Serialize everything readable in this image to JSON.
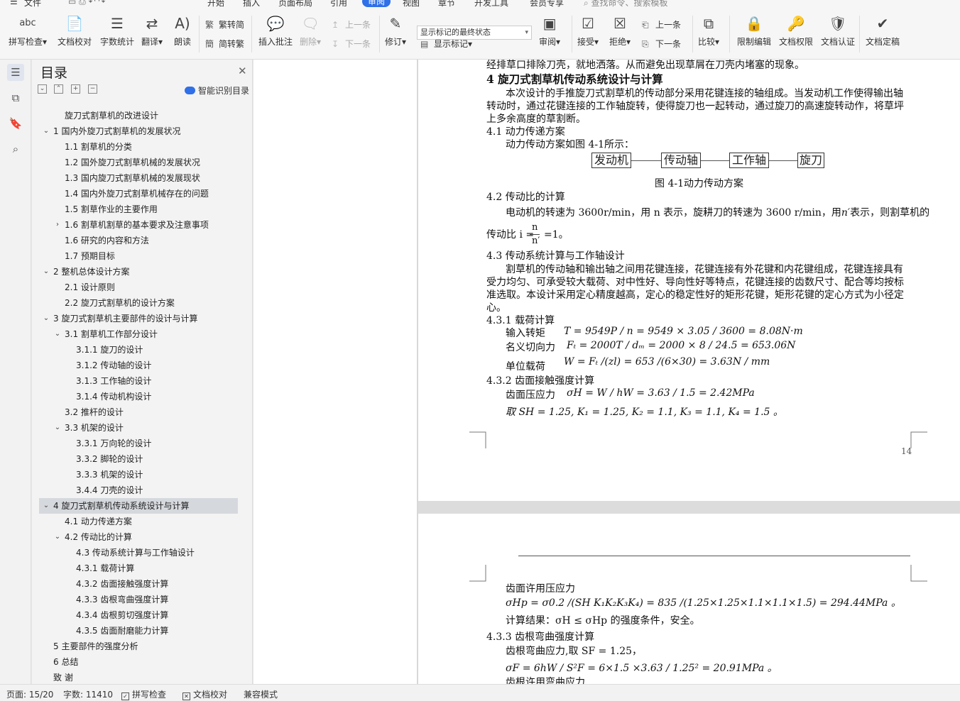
{
  "menubar": {
    "hamburger": "☰",
    "file": "文件",
    "items": [
      "开始",
      "插入",
      "页面布局",
      "引用",
      "审阅",
      "视图",
      "章节",
      "开发工具",
      "会员专享"
    ],
    "active_index": 4,
    "search": "查找命令、搜索模板"
  },
  "ribbon": {
    "spell_check": "拼写检查",
    "doc_proof": "文档校对",
    "word_count": "字数统计",
    "translate": "翻译",
    "read_aloud": "朗读",
    "trad_to_simp": "繁转简",
    "simp_to_trad": "简转繁",
    "insert_comment": "插入批注",
    "delete": "删除",
    "prev_comment": "上一条",
    "next_comment": "下一条",
    "revise": "修订",
    "markup_select": "显示标记的最终状态",
    "show_markup": "显示标记",
    "review": "审阅",
    "accept": "接受",
    "reject": "拒绝",
    "prev_change": "上一条",
    "next_change": "下一条",
    "compare": "比较",
    "restrict_edit": "限制编辑",
    "doc_permission": "文档权限",
    "doc_auth": "文档认证",
    "doc_finalize": "文档定稿"
  },
  "nav": {
    "title": "目录",
    "smart_toc": "智能识别目录",
    "items": [
      {
        "text": "旋刀式割草机的改进设计",
        "level": 1,
        "tw": ""
      },
      {
        "text": "1 国内外旋刀式割草机的发展状况",
        "level": 0,
        "tw": "v"
      },
      {
        "text": "1.1 割草机的分类",
        "level": 1,
        "tw": ""
      },
      {
        "text": "1.2 国外旋刀式割草机械的发展状况",
        "level": 1,
        "tw": ""
      },
      {
        "text": "1.3 国内旋刀式割草机械的发展现状",
        "level": 1,
        "tw": ""
      },
      {
        "text": "1.4 国内外旋刀式割草机械存在的问题",
        "level": 1,
        "tw": ""
      },
      {
        "text": "1.5 割草作业的主要作用",
        "level": 1,
        "tw": ""
      },
      {
        "text": "1.6 割草机割草的基本要求及注意事项",
        "level": 1,
        "tw": ">"
      },
      {
        "text": "1.6 研究的内容和方法",
        "level": 1,
        "tw": ""
      },
      {
        "text": "1.7 预期目标",
        "level": 1,
        "tw": ""
      },
      {
        "text": "2 整机总体设计方案",
        "level": 0,
        "tw": "v"
      },
      {
        "text": "2.1 设计原则",
        "level": 1,
        "tw": ""
      },
      {
        "text": "2.2 旋刀式割草机的设计方案",
        "level": 1,
        "tw": ""
      },
      {
        "text": "3 旋刀式割草机主要部件的设计与计算",
        "level": 0,
        "tw": "v"
      },
      {
        "text": "3.1 割草机工作部分设计",
        "level": 1,
        "tw": "v"
      },
      {
        "text": "3.1.1 旋刀的设计",
        "level": 2,
        "tw": ""
      },
      {
        "text": "3.1.2 传动轴的设计",
        "level": 2,
        "tw": ""
      },
      {
        "text": "3.1.3 工作轴的设计",
        "level": 2,
        "tw": ""
      },
      {
        "text": "3.1.4 传动机构设计",
        "level": 2,
        "tw": ""
      },
      {
        "text": "3.2 推杆的设计",
        "level": 1,
        "tw": ""
      },
      {
        "text": "3.3 机架的设计",
        "level": 1,
        "tw": "v"
      },
      {
        "text": "3.3.1 万向轮的设计",
        "level": 2,
        "tw": ""
      },
      {
        "text": "3.3.2 脚轮的设计",
        "level": 2,
        "tw": ""
      },
      {
        "text": "3.3.3 机架的设计",
        "level": 2,
        "tw": ""
      },
      {
        "text": "3.4.4 刀壳的设计",
        "level": 2,
        "tw": ""
      },
      {
        "text": "4 旋刀式割草机传动系统设计与计算",
        "level": 0,
        "tw": "v",
        "selected": true
      },
      {
        "text": "4.1 动力传递方案",
        "level": 1,
        "tw": ""
      },
      {
        "text": "4.2 传动比的计算",
        "level": 1,
        "tw": "v"
      },
      {
        "text": "4.3 传动系统计算与工作轴设计",
        "level": 2,
        "tw": ""
      },
      {
        "text": "4.3.1 载荷计算",
        "level": 2,
        "tw": ""
      },
      {
        "text": "4.3.2 齿面接触强度计算",
        "level": 2,
        "tw": ""
      },
      {
        "text": "4.3.3 齿根弯曲强度计算",
        "level": 2,
        "tw": ""
      },
      {
        "text": "4.3.4 齿根剪切强度计算",
        "level": 2,
        "tw": ""
      },
      {
        "text": "4.3.5 齿面耐磨能力计算",
        "level": 2,
        "tw": ""
      },
      {
        "text": "5 主要部件的强度分析",
        "level": 0,
        "tw": ""
      },
      {
        "text": "6 总结",
        "level": 0,
        "tw": ""
      },
      {
        "text": "致 谢",
        "level": 0,
        "tw": ""
      }
    ]
  },
  "doc": {
    "p0": "经排草口排除刀壳，就地洒落。从而避免出现草屑在刀壳内堵塞的现象。",
    "h4": "4 旋刀式割草机传动系统设计与计算",
    "p1a": "本次设计的手推旋刀式割草机的传动部分采用花键连接的轴组成。当发动机工作使得输出轴",
    "p1b": "转动时，通过花键连接的工作轴旋转，使得旋刀也一起转动，通过旋刀的高速旋转动作，将草坪",
    "p1c": "上多余高度的草割断。",
    "h41": "4.1 动力传递方案",
    "p2": "动力传动方案如图 4-1所示：",
    "flow": [
      "发动机",
      "传动轴",
      "工作轴",
      "旋刀"
    ],
    "fig_caption": "图 4-1动力传动方案",
    "h42": "4.2 传动比的计算",
    "p3": "电动机的转速为 3600r/min，用 n 表示，旋耕刀的转速为 3600 r/min，用",
    "p3_sym": "n′",
    "p3_end": "表示，则割草机的",
    "p4_label": "传动比 i =",
    "frac_num": "n",
    "frac_den": "n′",
    "p4_end": "=1。",
    "h43": "4.3 传动系统计算与工作轴设计",
    "p5a": "割草机的传动轴和输出轴之间用花键连接，花键连接有外花键和内花键组成，花键连接具有",
    "p5b": "受力均匀、可承受较大载荷、对中性好、导向性好等特点，花键连接的齿数尺寸、配合等均按标",
    "p5c": "准选取。本设计采用定心精度越高，定心的稳定性好的矩形花键，矩形花键的定心方式为小径定",
    "p5d": "心。",
    "h431": "4.3.1 载荷计算",
    "l1": "输入转矩",
    "f1": "T = 9549P / n = 9549 × 3.05 / 3600 = 8.08N·m",
    "l2": "名义切向力",
    "f2": "Fₜ = 2000T / dₘ = 2000 × 8 / 24.5 = 653.06N",
    "l3": "单位载荷",
    "f3": "W = Fₜ /(zl) = 653 /(6×30) = 3.63N / mm",
    "h432": "4.3.2 齿面接触强度计算",
    "l4": "齿面压应力",
    "f4": "σH = W / hW = 3.63 / 1.5 = 2.42MPa",
    "f5": "取 SH = 1.25, K₁ = 1.25, K₂ = 1.1, K₃ = 1.1, K₄ = 1.5 。",
    "page_num": "14",
    "p6": "齿面许用压应力",
    "f6": "σHp = σ0.2 /(SH K₁K₂K₃K₄) = 835 /(1.25×1.25×1.1×1.1×1.5) = 294.44MPa 。",
    "p7": "计算结果：σH ≤  σHp 的强度条件，安全。",
    "h433": "4.3.3 齿根弯曲强度计算",
    "p8": "齿根弯曲应力,取 SF = 1.25，",
    "f7": "σF = 6hW / S²F = 6×1.5 ×3.63 / 1.25² = 20.91MPa 。",
    "p9": "齿根许用弯曲应力"
  },
  "status": {
    "page": "页面: 15/20",
    "words": "字数: 11410",
    "spell": "拼写检查",
    "proof": "文档校对",
    "compat": "兼容模式"
  },
  "colors": {
    "accent": "#2f6fe8",
    "selected_row": "#d5d8dd"
  }
}
